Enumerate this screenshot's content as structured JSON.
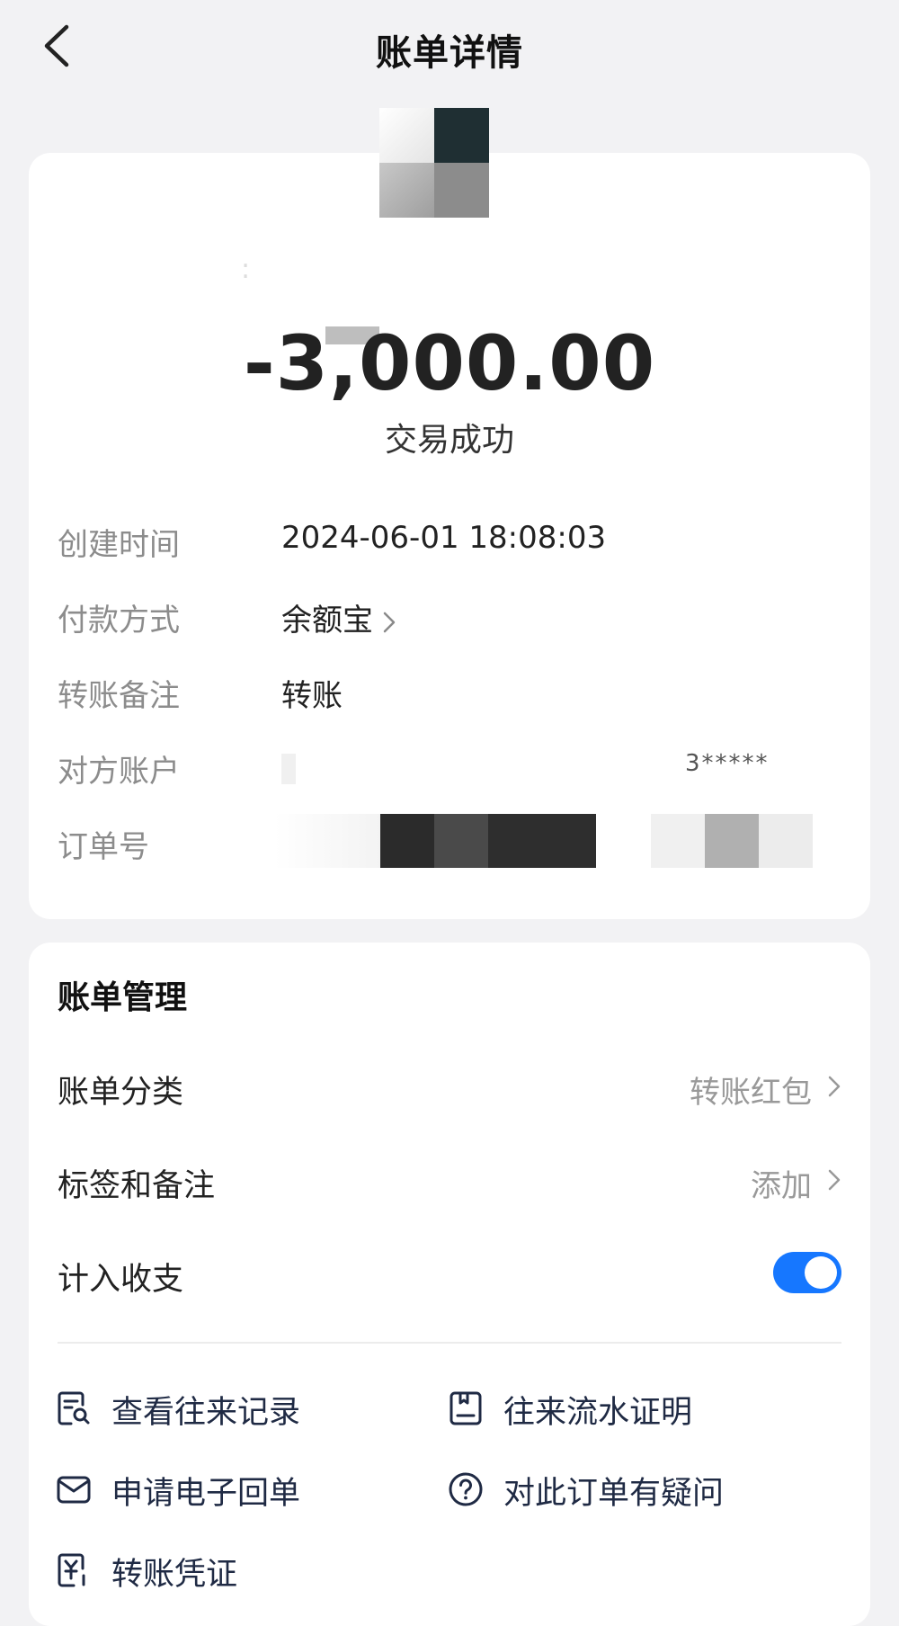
{
  "nav": {
    "title": "账单详情"
  },
  "amount": "-3,000.00",
  "status": "交易成功",
  "details": {
    "created_label": "创建时间",
    "created_value": "2024-06-01 18:08:03",
    "payment_label": "付款方式",
    "payment_value": "余额宝",
    "memo_label": "转账备注",
    "memo_value": "转账",
    "counterparty_label": "对方账户",
    "counterparty_value_tail": "3*****",
    "order_label": "订单号"
  },
  "management": {
    "title": "账单管理",
    "category_label": "账单分类",
    "category_value": "转账红包",
    "tags_label": "标签和备注",
    "tags_value": "添加",
    "include_label": "计入收支",
    "include_enabled": true
  },
  "actions": {
    "history": "查看往来记录",
    "statement": "往来流水证明",
    "receipt": "申请电子回单",
    "question": "对此订单有疑问",
    "voucher": "转账凭证"
  },
  "colors": {
    "accent": "#1677ff",
    "icon": "#1f2a44",
    "background": "#f2f2f4"
  }
}
